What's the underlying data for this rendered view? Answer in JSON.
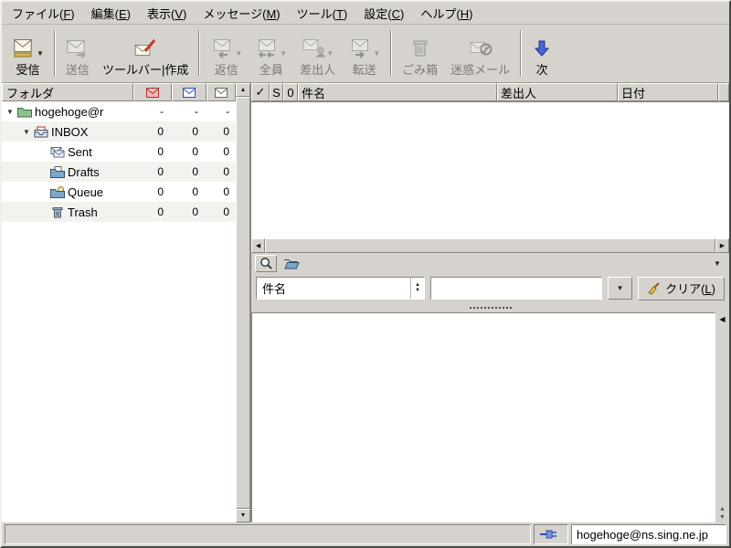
{
  "menu_bar": {
    "items": [
      {
        "pre": "ファイル(",
        "accel": "F",
        "post": ")"
      },
      {
        "pre": "編集(",
        "accel": "E",
        "post": ")"
      },
      {
        "pre": "表示(",
        "accel": "V",
        "post": ")"
      },
      {
        "pre": "メッセージ(",
        "accel": "M",
        "post": ")"
      },
      {
        "pre": "ツール(",
        "accel": "T",
        "post": ")"
      },
      {
        "pre": "設定(",
        "accel": "C",
        "post": ")"
      },
      {
        "pre": "ヘルプ(",
        "accel": "H",
        "post": ")"
      }
    ]
  },
  "toolbar": {
    "buttons": [
      {
        "id": "receive",
        "label": "受信",
        "icon": "receive-mail-icon",
        "dropdown": true,
        "enabled": true
      },
      {
        "id": "send",
        "label": "送信",
        "icon": "send-mail-icon",
        "dropdown": false,
        "enabled": false
      },
      {
        "id": "compose",
        "label": "ツールバー|作成",
        "icon": "compose-mail-icon",
        "dropdown": false,
        "enabled": true
      },
      {
        "id": "reply",
        "label": "返信",
        "icon": "reply-icon",
        "dropdown": true,
        "enabled": false
      },
      {
        "id": "reply-all",
        "label": "全員",
        "icon": "reply-all-icon",
        "dropdown": true,
        "enabled": false
      },
      {
        "id": "reply-sender",
        "label": "差出人",
        "icon": "reply-sender-icon",
        "dropdown": true,
        "enabled": false
      },
      {
        "id": "forward",
        "label": "転送",
        "icon": "forward-icon",
        "dropdown": true,
        "enabled": false
      },
      {
        "id": "trash",
        "label": "ごみ箱",
        "icon": "trash-icon",
        "dropdown": false,
        "enabled": false
      },
      {
        "id": "junk",
        "label": "迷惑メール",
        "icon": "junk-mail-icon",
        "dropdown": false,
        "enabled": false
      },
      {
        "id": "next",
        "label": "次",
        "icon": "next-arrow-icon",
        "dropdown": false,
        "enabled": true
      }
    ]
  },
  "folder_pane": {
    "header": {
      "title": "フォルダ",
      "col_icons": [
        "new-mail-column-icon",
        "unread-mail-column-icon",
        "total-mail-column-icon"
      ]
    },
    "rows": [
      {
        "label": "hogehoge@r",
        "icon": "account-folder-icon",
        "expanded": true,
        "level": 0,
        "new": "-",
        "unread": "-",
        "total": "-"
      },
      {
        "label": "INBOX",
        "icon": "inbox-icon",
        "expanded": true,
        "level": 1,
        "new": "0",
        "unread": "0",
        "total": "0"
      },
      {
        "label": "Sent",
        "icon": "sent-folder-icon",
        "expanded": false,
        "level": 2,
        "new": "0",
        "unread": "0",
        "total": "0"
      },
      {
        "label": "Drafts",
        "icon": "drafts-folder-icon",
        "expanded": false,
        "level": 2,
        "new": "0",
        "unread": "0",
        "total": "0"
      },
      {
        "label": "Queue",
        "icon": "queue-folder-icon",
        "expanded": false,
        "level": 2,
        "new": "0",
        "unread": "0",
        "total": "0"
      },
      {
        "label": "Trash",
        "icon": "trash-folder-icon",
        "expanded": false,
        "level": 2,
        "new": "0",
        "unread": "0",
        "total": "0"
      }
    ]
  },
  "message_list": {
    "columns": [
      {
        "label": "✓"
      },
      {
        "label": "S"
      },
      {
        "label": "0"
      },
      {
        "label": "件名"
      },
      {
        "label": "差出人"
      },
      {
        "label": "日付"
      }
    ],
    "rows": []
  },
  "search": {
    "field_selector": {
      "value": "件名"
    },
    "input": {
      "value": "",
      "placeholder": ""
    },
    "clear_button": {
      "pre": "クリア(",
      "accel": "L",
      "post": ")"
    }
  },
  "status_bar": {
    "account": "hogehoge@ns.sing.ne.jp"
  },
  "colors": {
    "window_bg": "#d6d3ce",
    "next_arrow_blue": "#4a63d8",
    "disabled_text": "#7d7b75"
  }
}
